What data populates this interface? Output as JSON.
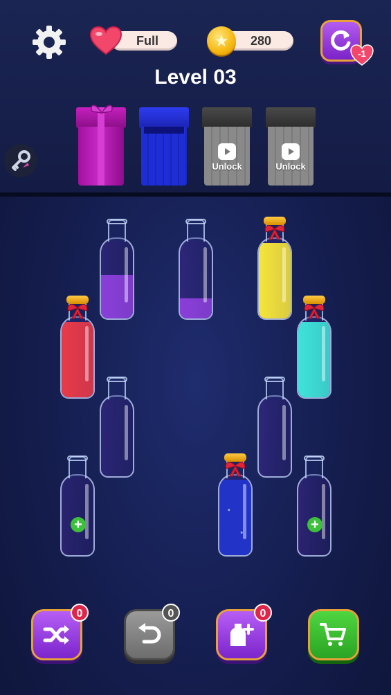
{
  "header": {
    "lives_label": "Full",
    "coins": "280",
    "restart_badge": "-1",
    "level_title": "Level 03"
  },
  "boxes": [
    {
      "name": "gift-box",
      "state": "locked-gift"
    },
    {
      "name": "blue-box",
      "state": "open"
    },
    {
      "name": "locked-box-1",
      "unlock_label": "Unlock"
    },
    {
      "name": "locked-box-2",
      "unlock_label": "Unlock"
    }
  ],
  "bottles": [
    {
      "color": "#8a3fd8",
      "fill": 0.55,
      "sealed": false
    },
    {
      "color": "#8a3fd8",
      "fill": 0.25,
      "sealed": false
    },
    {
      "color": "#f6e53a",
      "fill": 0.95,
      "sealed": true
    },
    {
      "color": "#e83a48",
      "fill": 0.95,
      "sealed": true
    },
    {
      "color": "#3ee3d8",
      "fill": 0.95,
      "sealed": true
    },
    {
      "color": "",
      "fill": 0,
      "sealed": false
    },
    {
      "color": "",
      "fill": 0,
      "sealed": false
    },
    {
      "color": "",
      "fill": 0,
      "sealed": false,
      "add": true
    },
    {
      "color": "#2233c8",
      "fill": 0.95,
      "sealed": true,
      "sparkle": true
    },
    {
      "color": "",
      "fill": 0,
      "sealed": false,
      "add": true
    }
  ],
  "add_symbol": "+",
  "toolbar": {
    "shuffle_count": "0",
    "undo_count": "0",
    "add_bottle_count": "0"
  },
  "colors": {
    "accent_purple": "#7b25cc",
    "accent_green": "#2ba424",
    "badge_red": "#e0254a"
  },
  "icons": [
    "gear-icon",
    "heart-icon",
    "star-coin-icon",
    "restart-icon",
    "key-icon",
    "shuffle-icon",
    "undo-icon",
    "add-bottle-icon",
    "cart-icon",
    "play-video-icon"
  ]
}
